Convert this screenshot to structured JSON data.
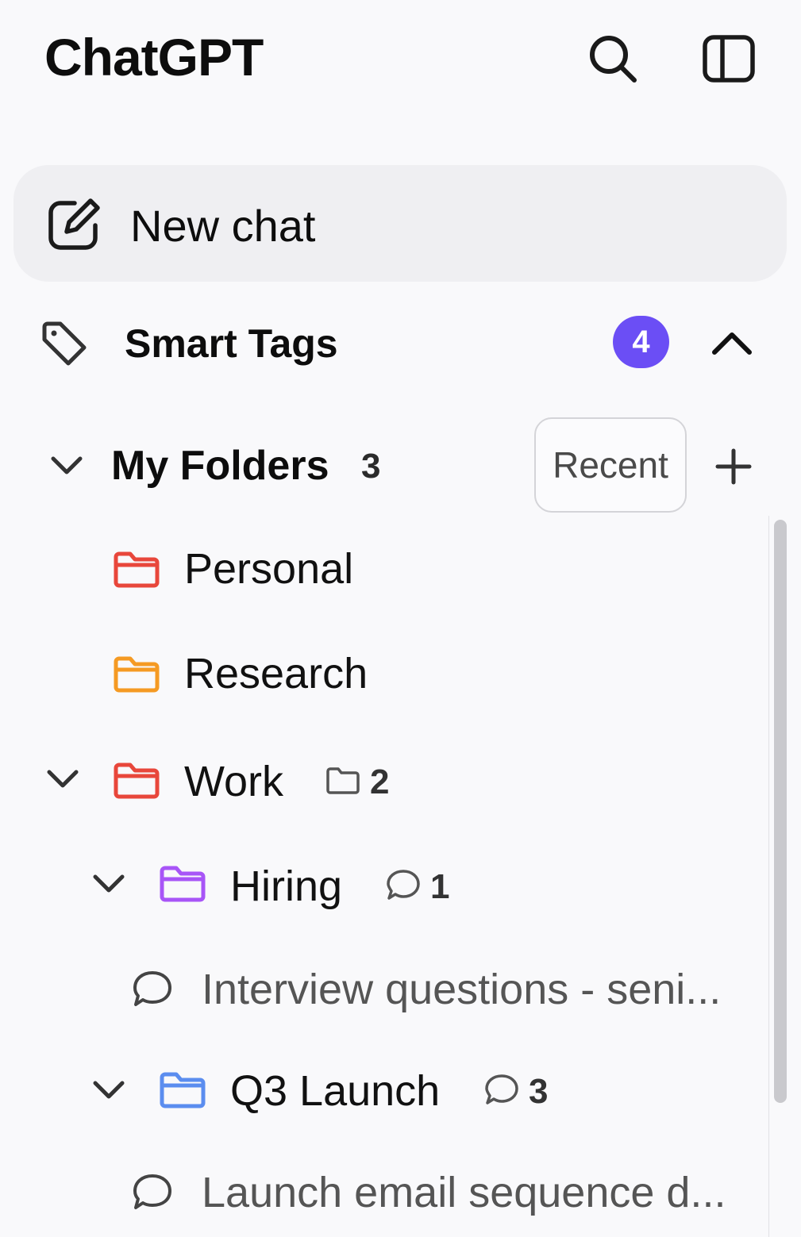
{
  "app": {
    "title": "ChatGPT"
  },
  "header": {
    "search_icon": "search-icon",
    "sidebar_icon": "sidebar-toggle-icon"
  },
  "new_chat": {
    "label": "New chat",
    "icon": "edit-icon"
  },
  "smart_tags": {
    "label": "Smart Tags",
    "badge": "4",
    "icon": "tag-icon"
  },
  "folders": {
    "label": "My Folders",
    "count": "3",
    "recent_label": "Recent",
    "items": [
      {
        "label": "Personal",
        "color": "#e8473b"
      },
      {
        "label": "Research",
        "color": "#f59a23"
      },
      {
        "label": "Work",
        "color": "#e8473b",
        "subfolder_count": "2",
        "children": [
          {
            "label": "Hiring",
            "color": "#a855f7",
            "chat_count": "1",
            "chats": [
              {
                "label": "Interview questions - seni..."
              }
            ]
          },
          {
            "label": "Q3 Launch",
            "color": "#5b8def",
            "chat_count": "3",
            "chats": [
              {
                "label": "Launch email sequence d..."
              }
            ]
          }
        ]
      }
    ]
  },
  "colors": {
    "accent": "#6b4ef5",
    "background": "#f9f9fb",
    "new_chat_bg": "#efeff2"
  }
}
